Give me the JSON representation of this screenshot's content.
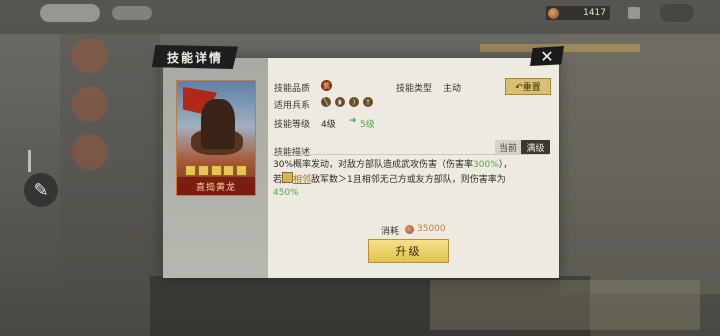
{
  "hud": {
    "currency_value": "1417"
  },
  "modal": {
    "title": "技能详情",
    "close_glyph": "✕",
    "card_name": "直捣黄龙",
    "labels": {
      "quality": "技能品质",
      "type": "技能类型",
      "troops": "适用兵系",
      "level": "技能等级",
      "desc": "技能描述"
    },
    "values": {
      "quality_badge": "紫",
      "type": "主动",
      "level": "4级",
      "up_arrow": "➜",
      "up_level": "5级"
    },
    "troop_icons": [
      "spear-icon",
      "shield-icon",
      "bow-icon",
      "sword-icon"
    ],
    "reset_label": "↶重置",
    "tabs": {
      "current": "当前",
      "max": "满级"
    },
    "description": {
      "line1_a": "30%概率发动，对敌方部队造成武攻伤害（伤害率",
      "line1_pct": "300%",
      "line1_b": "），",
      "line2_a": "若",
      "line2_neighbor": "相邻",
      "line2_b": "敌军数＞1且相邻无己方或友方部队，则伤害率为",
      "line3_pct": "450%"
    },
    "cost_label": "消耗",
    "cost_value": "35000",
    "upgrade_label": "升级"
  }
}
